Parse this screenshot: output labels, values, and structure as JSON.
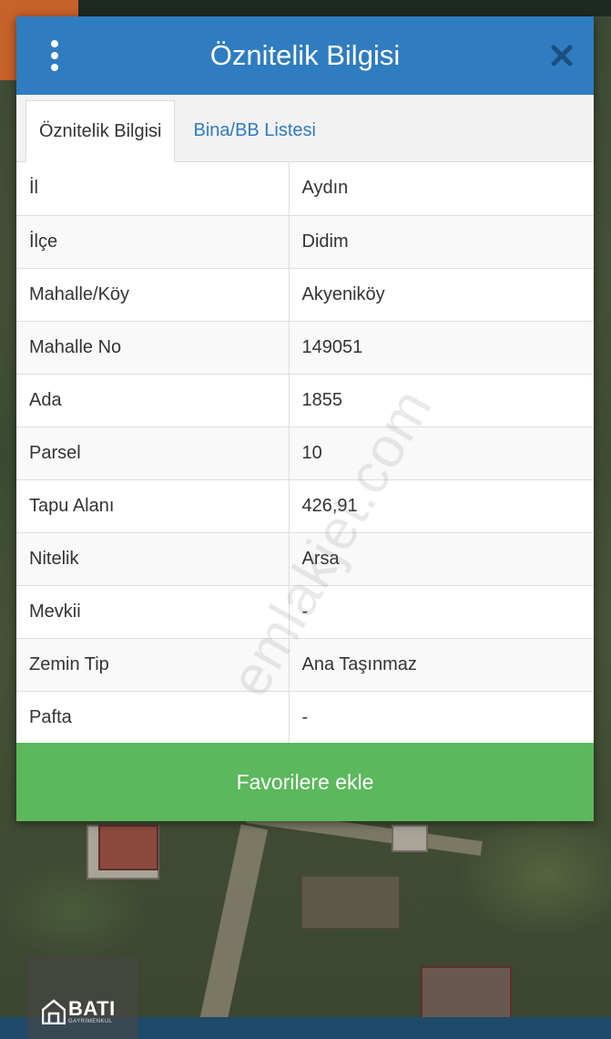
{
  "modal": {
    "title": "Öznitelik Bilgisi",
    "tabs": [
      {
        "label": "Öznitelik Bilgisi",
        "active": true
      },
      {
        "label": "Bina/BB Listesi",
        "active": false
      }
    ],
    "attributes": [
      {
        "key": "İl",
        "value": "Aydın"
      },
      {
        "key": "İlçe",
        "value": "Didim"
      },
      {
        "key": "Mahalle/Köy",
        "value": "Akyeniköy"
      },
      {
        "key": "Mahalle No",
        "value": "149051"
      },
      {
        "key": "Ada",
        "value": "1855"
      },
      {
        "key": "Parsel",
        "value": "10"
      },
      {
        "key": "Tapu Alanı",
        "value": "426,91"
      },
      {
        "key": "Nitelik",
        "value": "Arsa"
      },
      {
        "key": "Mevkii",
        "value": "-"
      },
      {
        "key": "Zemin Tip",
        "value": "Ana Taşınmaz"
      },
      {
        "key": "Pafta",
        "value": "-"
      }
    ],
    "favorite_button": "Favorilere ekle"
  },
  "icons": {
    "menu": "kebab-menu-icon",
    "close": "close-icon"
  },
  "watermark": "emlakjet.com",
  "logo": {
    "name": "BATI",
    "subtitle": "GAYRİMENKUL"
  },
  "colors": {
    "header": "#2f7cc0",
    "button": "#5cb85c",
    "tab_link": "#2f7cc0"
  }
}
